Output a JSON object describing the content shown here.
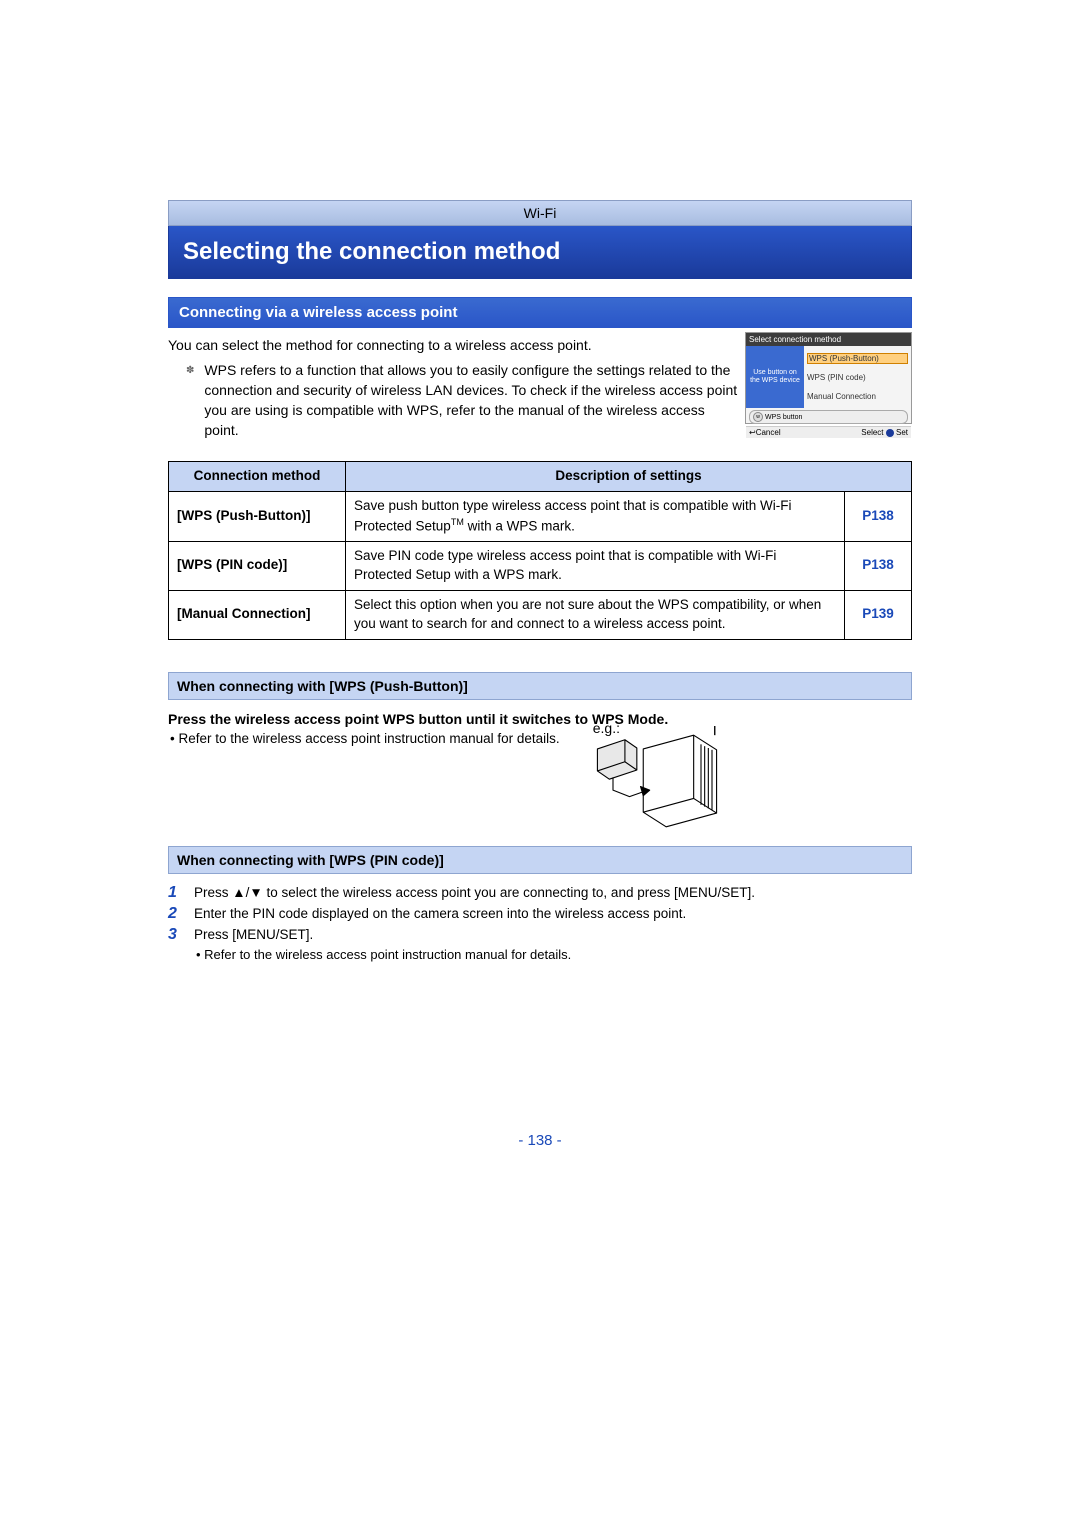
{
  "header": {
    "chapter": "Wi-Fi"
  },
  "title": "Selecting the connection method",
  "subtitle": "Connecting via a wireless access point",
  "intro": "You can select the method for connecting to a wireless access point.",
  "wps_note": "WPS refers to a function that allows you to easily configure the settings related to the connection and security of wireless LAN devices. To check if the wireless access point you are using is compatible with WPS, refer to the manual of the wireless access point.",
  "ui_thumb": {
    "title": "Select connection method",
    "left_line1": "Use button on",
    "left_line2": "the WPS device",
    "opt1": "WPS (Push-Button)",
    "opt2": "WPS (PIN code)",
    "opt3": "Manual Connection",
    "wps_btn": "WPS button",
    "cancel": "Cancel",
    "select": "Select",
    "set": "Set"
  },
  "table": {
    "head_method": "Connection method",
    "head_desc": "Description of settings",
    "rows": [
      {
        "method": "[WPS (Push-Button)]",
        "desc_pre": "Save push button type wireless access point that is compatible with Wi-Fi Protected Setup",
        "desc_post": " with a WPS mark.",
        "page": "P138"
      },
      {
        "method": "[WPS (PIN code)]",
        "desc": "Save PIN code type wireless access point that is compatible with Wi-Fi Protected Setup with a WPS mark.",
        "page": "P138"
      },
      {
        "method": "[Manual Connection]",
        "desc": "Select this option when you are not sure about the WPS compatibility, or when you want to search for and connect to a wireless access point.",
        "page": "P139"
      }
    ]
  },
  "push_button_section": {
    "heading": "When connecting with [WPS (Push-Button)]",
    "instruction": "Press the wireless access point WPS button until it switches to WPS Mode.",
    "eg": "e.g.:",
    "bullet": "Refer to the wireless access point instruction manual for details."
  },
  "pin_section": {
    "heading": "When connecting with [WPS (PIN code)]",
    "steps": [
      {
        "pre": "Press ",
        "sym": "▲/▼",
        "post": " to select the wireless access point you are connecting to, and press [MENU/SET]."
      },
      {
        "text": "Enter the PIN code displayed on the camera screen into the wireless access point."
      },
      {
        "text": "Press [MENU/SET]."
      }
    ],
    "sub_bullet": "Refer to the wireless access point instruction manual for details."
  },
  "page_number": "- 138 -"
}
